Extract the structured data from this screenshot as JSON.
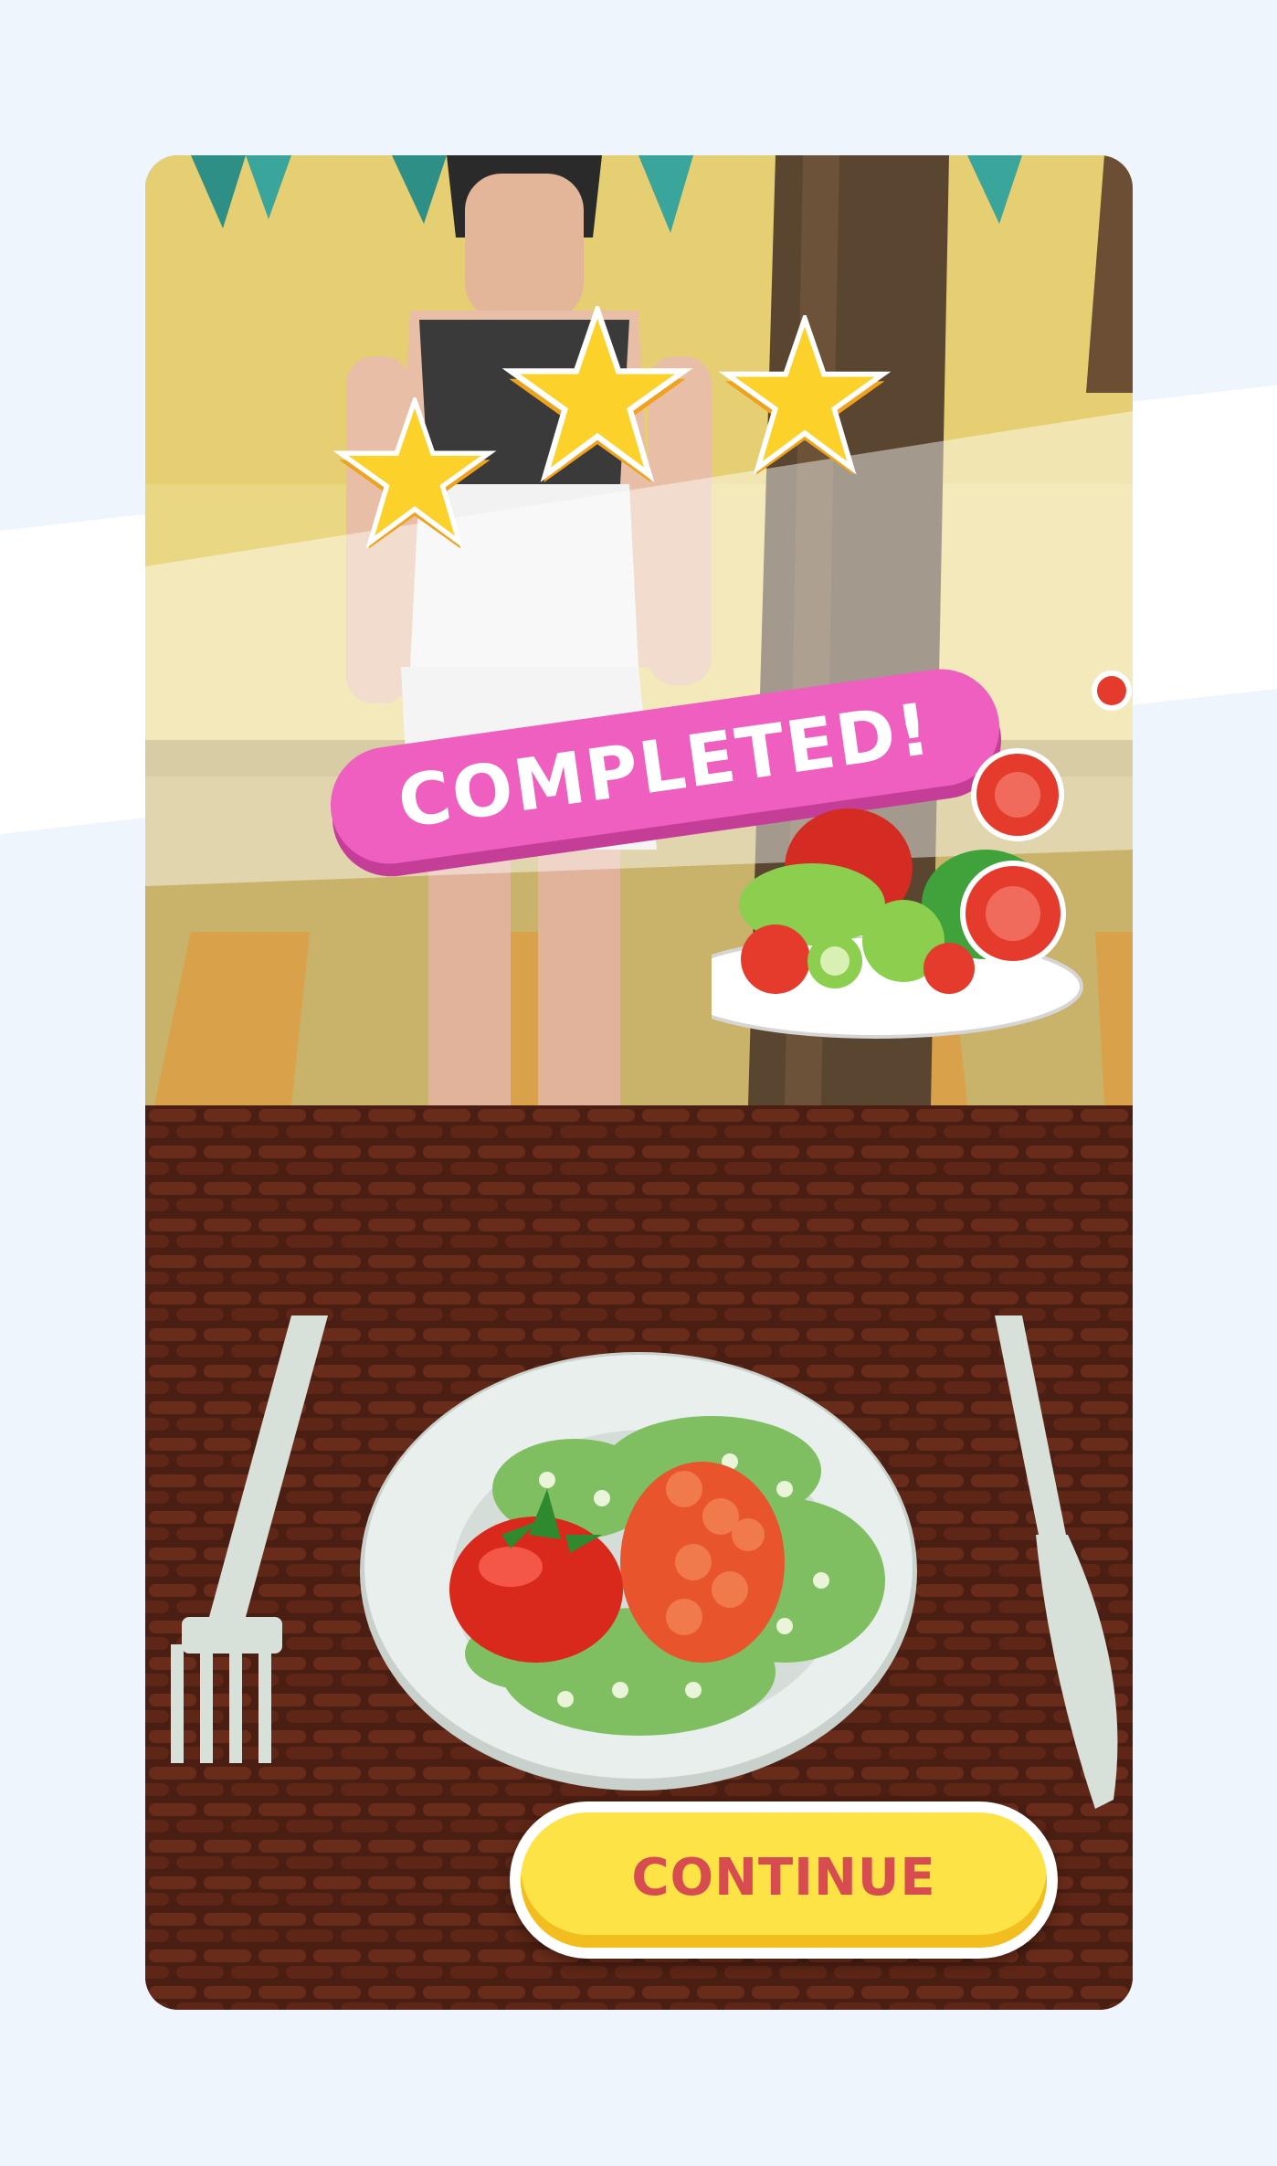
{
  "result": {
    "title": "COMPLETED!",
    "stars_earned": 3,
    "stars_total": 3
  },
  "actions": {
    "continue_label": "CONTINUE"
  },
  "icons": {
    "stars": "star-icon",
    "reward": "salad-plate-icon"
  },
  "colors": {
    "completed_pill": "#ef5fbf",
    "continue_button": "#fde346",
    "continue_text": "#d74c4f",
    "star": "#fbd12a",
    "page_background": "#eef5fc"
  }
}
